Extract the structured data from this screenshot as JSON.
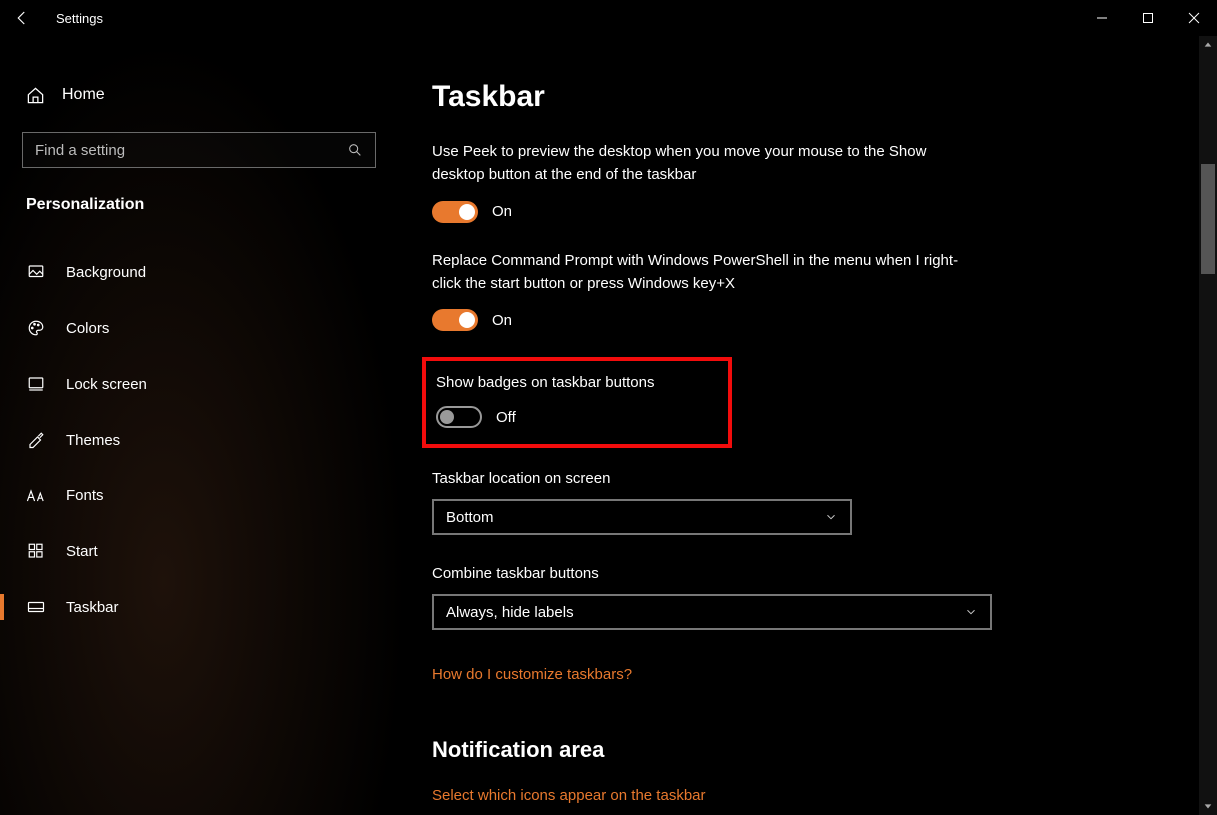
{
  "titlebar": {
    "app_title": "Settings"
  },
  "sidebar": {
    "home_label": "Home",
    "search_placeholder": "Find a setting",
    "section_title": "Personalization",
    "items": [
      {
        "label": "Background"
      },
      {
        "label": "Colors"
      },
      {
        "label": "Lock screen"
      },
      {
        "label": "Themes"
      },
      {
        "label": "Fonts"
      },
      {
        "label": "Start"
      },
      {
        "label": "Taskbar"
      }
    ]
  },
  "main": {
    "page_title": "Taskbar",
    "peek": {
      "desc": "Use Peek to preview the desktop when you move your mouse to the Show desktop button at the end of the taskbar",
      "state": "On"
    },
    "powershell": {
      "desc": "Replace Command Prompt with Windows PowerShell in the menu when I right-click the start button or press Windows key+X",
      "state": "On"
    },
    "badges": {
      "desc": "Show badges on taskbar buttons",
      "state": "Off"
    },
    "location": {
      "label": "Taskbar location on screen",
      "value": "Bottom"
    },
    "combine": {
      "label": "Combine taskbar buttons",
      "value": "Always, hide labels"
    },
    "help_link": "How do I customize taskbars?",
    "notification_heading": "Notification area",
    "notification_link": "Select which icons appear on the taskbar"
  }
}
